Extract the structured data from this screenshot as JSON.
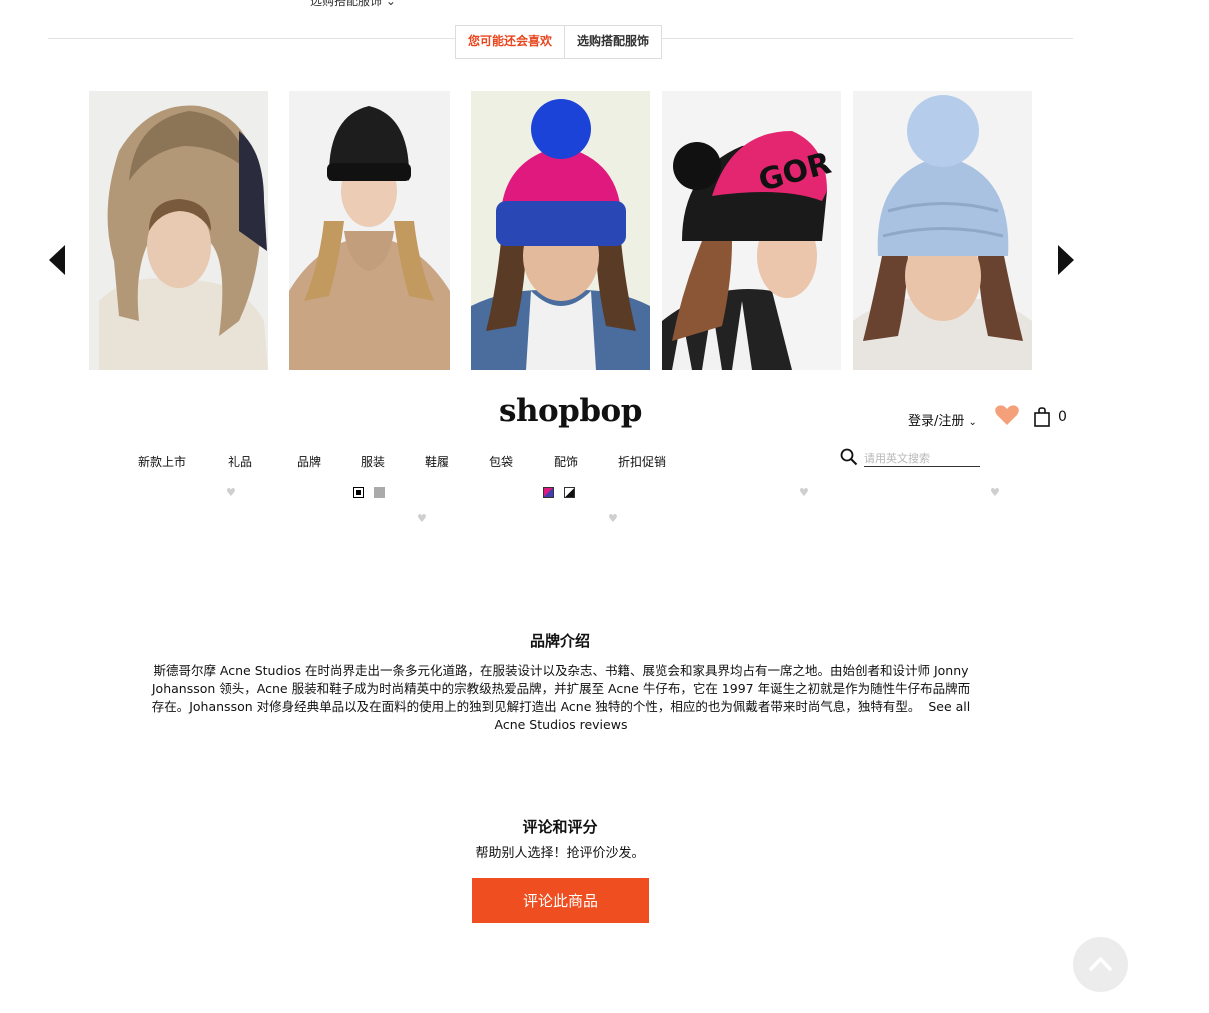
{
  "top_cut_text": "选购搭配服饰 ⌄",
  "tabs": [
    {
      "label": "您可能还会喜欢",
      "active": true
    },
    {
      "label": "选购搭配服饰",
      "active": false
    }
  ],
  "header": {
    "logo": "shopbop",
    "account_label": "登录/注册",
    "bag_count": "0"
  },
  "nav": [
    "新款上市",
    "礼品",
    "品牌",
    "服装",
    "鞋履",
    "包袋",
    "配饰",
    "折扣促销"
  ],
  "search": {
    "placeholder": "请用英文搜索"
  },
  "colors": {
    "accent": "#ef4e20",
    "heart": "#f4a07a",
    "active_tab": "#e8461d"
  },
  "products": [
    {
      "icon": "fur-trapper-hat",
      "bg": "#eeeeec",
      "hat": "#b39877"
    },
    {
      "icon": "black-beanie",
      "bg": "#f2f2f2",
      "hat": "#1d1d1d"
    },
    {
      "icon": "pink-blue-pom-beanie",
      "bg": "#eef0e4",
      "hat": "#e0197e"
    },
    {
      "icon": "pink-black-gore-beanie",
      "bg": "#f4f4f4",
      "hat": "#e4256f"
    },
    {
      "icon": "light-blue-chunky-pom-beanie",
      "bg": "#f3f3f3",
      "hat": "#a9c2e1"
    }
  ],
  "swatches": [
    {
      "color": "#000000",
      "product": 2
    },
    {
      "color": "#aaaaaa",
      "product": 2
    },
    {
      "color": "#3e3fb0",
      "product": 3
    },
    {
      "color": "#1a1a1a",
      "product": 3
    }
  ],
  "brand": {
    "title": "品牌介绍",
    "description": "斯德哥尔摩 Acne Studios 在时尚界走出一条多元化道路，在服装设计以及杂志、书籍、展览会和家具界均占有一席之地。由始创者和设计师 Jonny Johansson 领头，Acne 服装和鞋子成为时尚精英中的宗教级热爱品牌，并扩展至 Acne 牛仔布，它在 1997 年诞生之初就是作为随性牛仔布品牌而存在。Johansson 对修身经典单品以及在面料的使用上的独到见解打造出 Acne 独特的个性，相应的也为佩戴者带来时尚气息，独特有型。",
    "link": "See all Acne Studios reviews"
  },
  "reviews": {
    "title": "评论和评分",
    "subtitle": "帮助别人选择！抢评价沙发。",
    "button": "评论此商品"
  }
}
